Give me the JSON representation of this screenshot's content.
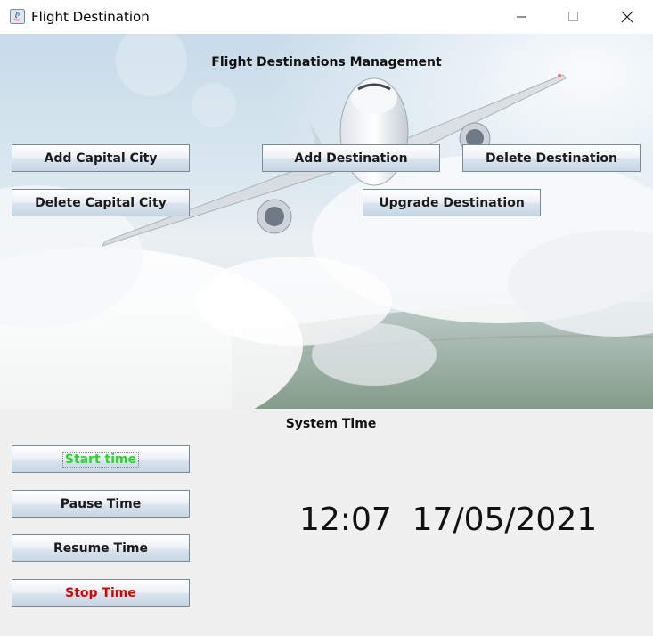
{
  "window": {
    "title": "Flight Destination",
    "controls": {
      "minimize": "minimize-icon",
      "maximize": "maximize-icon",
      "close": "close-icon"
    }
  },
  "hero": {
    "title": "Flight Destinations Management",
    "buttons": {
      "add_capital": "Add Capital City",
      "add_destination": "Add Destination",
      "delete_destination": "Delete Destination",
      "delete_capital": "Delete Capital City",
      "upgrade_destination": "Upgrade Destination"
    }
  },
  "time_panel": {
    "label": "System Time",
    "buttons": {
      "start": "Start time",
      "pause": "Pause Time",
      "resume": "Resume Time",
      "stop": "Stop Time"
    },
    "clock": {
      "time": "12:07",
      "date": "17/05/2021"
    },
    "colors": {
      "start_text": "#22dd22",
      "stop_text": "#dd0000"
    }
  }
}
